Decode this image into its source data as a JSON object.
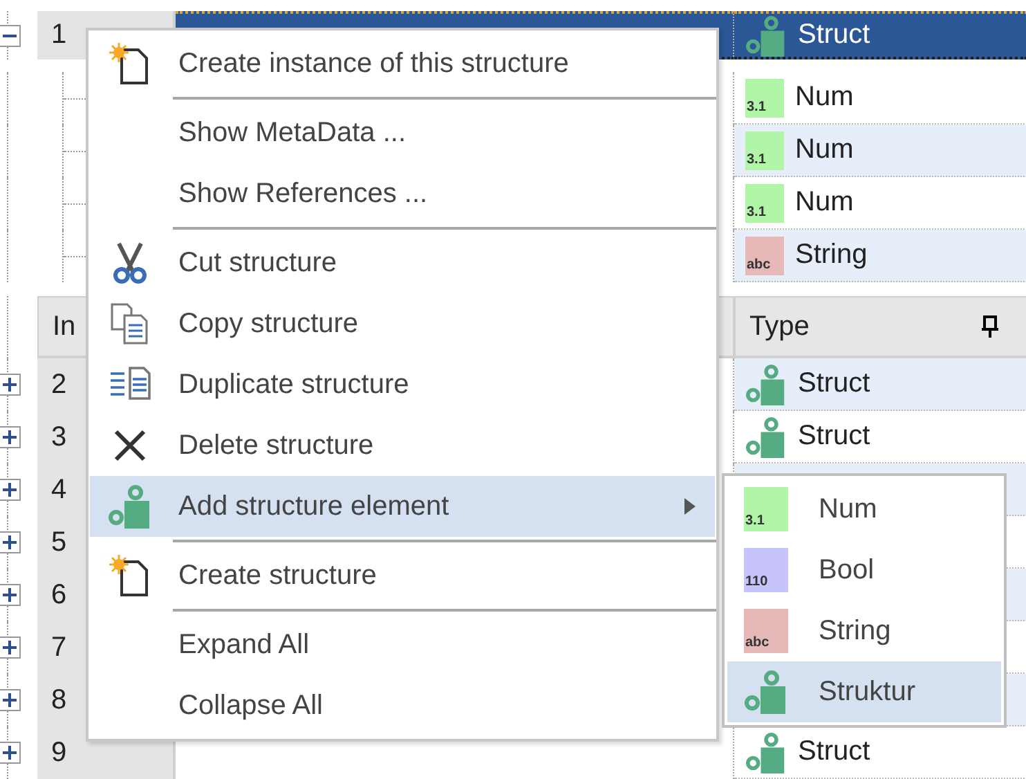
{
  "grid": {
    "expanded_row": {
      "index": "1",
      "type": "Struct",
      "kind": "struct",
      "selected": true,
      "expanded": true
    },
    "children": [
      {
        "type": "Num",
        "kind": "num",
        "badge": "3.1"
      },
      {
        "type": "Num",
        "kind": "num",
        "badge": "3.1"
      },
      {
        "type": "Num",
        "kind": "num",
        "badge": "3.1"
      },
      {
        "type": "String",
        "kind": "string",
        "badge": "abc"
      }
    ],
    "header": {
      "index": "In",
      "type": "Type"
    },
    "rows": [
      {
        "index": "2",
        "type": "Struct",
        "kind": "struct",
        "expanded": false
      },
      {
        "index": "3",
        "type": "Struct",
        "kind": "struct",
        "expanded": false
      },
      {
        "index": "4",
        "expanded": false
      },
      {
        "index": "5",
        "expanded": false
      },
      {
        "index": "6",
        "expanded": false
      },
      {
        "index": "7",
        "expanded": false
      },
      {
        "index": "8",
        "expanded": false
      },
      {
        "index": "9",
        "type": "Struct",
        "kind": "struct",
        "expanded": false
      }
    ]
  },
  "context_menu": {
    "items": [
      {
        "kind": "new",
        "label": "Create instance of this structure",
        "selected": false
      },
      {
        "kind": "separator"
      },
      {
        "kind": "plain",
        "label": "Show MetaData ...",
        "selected": false
      },
      {
        "kind": "plain",
        "label": "Show References ...",
        "selected": false
      },
      {
        "kind": "separator"
      },
      {
        "kind": "cut",
        "label": "Cut structure",
        "selected": false
      },
      {
        "kind": "copy",
        "label": "Copy structure",
        "selected": false
      },
      {
        "kind": "duplicate",
        "label": "Duplicate structure",
        "selected": false
      },
      {
        "kind": "delete",
        "label": "Delete structure",
        "selected": false
      },
      {
        "kind": "struct",
        "label": "Add structure element",
        "selected": true,
        "submenu": true
      },
      {
        "kind": "separator"
      },
      {
        "kind": "new",
        "label": "Create structure",
        "selected": false
      },
      {
        "kind": "separator"
      },
      {
        "kind": "plain",
        "label": "Expand All",
        "selected": false
      },
      {
        "kind": "plain",
        "label": "Collapse All",
        "selected": false
      }
    ]
  },
  "submenu": {
    "items": [
      {
        "kind": "num",
        "badge": "3.1",
        "label": "Num",
        "selected": false
      },
      {
        "kind": "bool",
        "badge": "110",
        "label": "Bool",
        "selected": false
      },
      {
        "kind": "string",
        "badge": "abc",
        "label": "String",
        "selected": false
      },
      {
        "kind": "struct",
        "label": "Struktur",
        "selected": true
      }
    ]
  }
}
